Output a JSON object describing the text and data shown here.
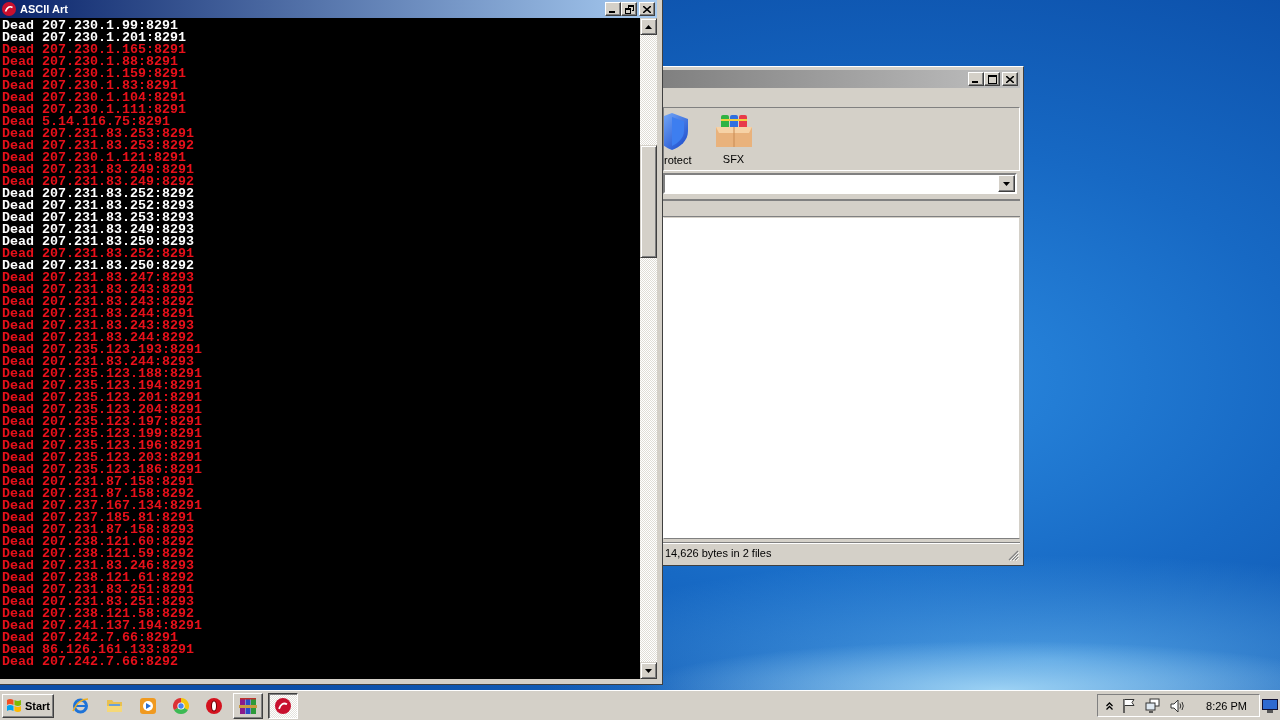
{
  "console_window": {
    "title": "ASCII Art",
    "active": true,
    "lines": [
      {
        "text": "Dead 207.230.1.99:8291",
        "color": "#ffffff"
      },
      {
        "text": "Dead 207.230.1.201:8291",
        "color": "#ffffff"
      },
      {
        "text": "Dead 207.230.1.165:8291",
        "color": "#e8101a"
      },
      {
        "text": "Dead 207.230.1.88:8291",
        "color": "#e8101a"
      },
      {
        "text": "Dead 207.230.1.159:8291",
        "color": "#e8101a"
      },
      {
        "text": "Dead 207.230.1.83:8291",
        "color": "#e8101a"
      },
      {
        "text": "Dead 207.230.1.104:8291",
        "color": "#e8101a"
      },
      {
        "text": "Dead 207.230.1.111:8291",
        "color": "#e8101a"
      },
      {
        "text": "Dead 5.14.116.75:8291",
        "color": "#e8101a"
      },
      {
        "text": "Dead 207.231.83.253:8291",
        "color": "#e8101a"
      },
      {
        "text": "Dead 207.231.83.253:8292",
        "color": "#e8101a"
      },
      {
        "text": "Dead 207.230.1.121:8291",
        "color": "#e8101a"
      },
      {
        "text": "Dead 207.231.83.249:8291",
        "color": "#e8101a"
      },
      {
        "text": "Dead 207.231.83.249:8292",
        "color": "#e8101a"
      },
      {
        "text": "Dead 207.231.83.252:8292",
        "color": "#ffffff"
      },
      {
        "text": "Dead 207.231.83.252:8293",
        "color": "#ffffff"
      },
      {
        "text": "Dead 207.231.83.253:8293",
        "color": "#ffffff"
      },
      {
        "text": "Dead 207.231.83.249:8293",
        "color": "#ffffff"
      },
      {
        "text": "Dead 207.231.83.250:8293",
        "color": "#ffffff"
      },
      {
        "text": "Dead 207.231.83.252:8291",
        "color": "#e8101a"
      },
      {
        "text": "Dead 207.231.83.250:8292",
        "color": "#ffffff"
      },
      {
        "text": "Dead 207.231.83.247:8293",
        "color": "#e8101a"
      },
      {
        "text": "Dead 207.231.83.243:8291",
        "color": "#e8101a"
      },
      {
        "text": "Dead 207.231.83.243:8292",
        "color": "#e8101a"
      },
      {
        "text": "Dead 207.231.83.244:8291",
        "color": "#e8101a"
      },
      {
        "text": "Dead 207.231.83.243:8293",
        "color": "#e8101a"
      },
      {
        "text": "Dead 207.231.83.244:8292",
        "color": "#e8101a"
      },
      {
        "text": "Dead 207.235.123.193:8291",
        "color": "#e8101a"
      },
      {
        "text": "Dead 207.231.83.244:8293",
        "color": "#e8101a"
      },
      {
        "text": "Dead 207.235.123.188:8291",
        "color": "#e8101a"
      },
      {
        "text": "Dead 207.235.123.194:8291",
        "color": "#e8101a"
      },
      {
        "text": "Dead 207.235.123.201:8291",
        "color": "#e8101a"
      },
      {
        "text": "Dead 207.235.123.204:8291",
        "color": "#e8101a"
      },
      {
        "text": "Dead 207.235.123.197:8291",
        "color": "#e8101a"
      },
      {
        "text": "Dead 207.235.123.199:8291",
        "color": "#e8101a"
      },
      {
        "text": "Dead 207.235.123.196:8291",
        "color": "#e8101a"
      },
      {
        "text": "Dead 207.235.123.203:8291",
        "color": "#e8101a"
      },
      {
        "text": "Dead 207.235.123.186:8291",
        "color": "#e8101a"
      },
      {
        "text": "Dead 207.231.87.158:8291",
        "color": "#e8101a"
      },
      {
        "text": "Dead 207.231.87.158:8292",
        "color": "#e8101a"
      },
      {
        "text": "Dead 207.237.167.134:8291",
        "color": "#e8101a"
      },
      {
        "text": "Dead 207.237.185.81:8291",
        "color": "#e8101a"
      },
      {
        "text": "Dead 207.231.87.158:8293",
        "color": "#e8101a"
      },
      {
        "text": "Dead 207.238.121.60:8292",
        "color": "#e8101a"
      },
      {
        "text": "Dead 207.238.121.59:8292",
        "color": "#e8101a"
      },
      {
        "text": "Dead 207.231.83.246:8293",
        "color": "#e8101a"
      },
      {
        "text": "Dead 207.238.121.61:8292",
        "color": "#e8101a"
      },
      {
        "text": "Dead 207.231.83.251:8291",
        "color": "#e8101a"
      },
      {
        "text": "Dead 207.231.83.251:8293",
        "color": "#e8101a"
      },
      {
        "text": "Dead 207.238.121.58:8292",
        "color": "#e8101a"
      },
      {
        "text": "Dead 207.241.137.194:8291",
        "color": "#e8101a"
      },
      {
        "text": "Dead 207.242.7.66:8291",
        "color": "#e8101a"
      },
      {
        "text": "Dead 86.126.161.133:8291",
        "color": "#e8101a"
      },
      {
        "text": "Dead 207.242.7.66:8292",
        "color": "#e8101a"
      }
    ]
  },
  "archive_window": {
    "active": false,
    "toolbar": [
      {
        "label": "rotect"
      },
      {
        "label": "SFX"
      }
    ],
    "status": "14,626 bytes in 2 files"
  },
  "taskbar": {
    "start": "Start",
    "tasks": [
      {
        "kind": "archiver",
        "selected": false
      },
      {
        "kind": "console",
        "selected": true
      }
    ],
    "clock": "8:26 PM"
  }
}
